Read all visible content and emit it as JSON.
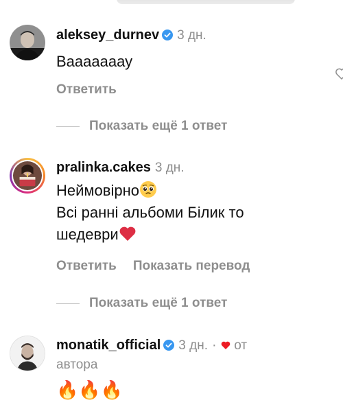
{
  "comments": [
    {
      "username": "aleksey_durnev",
      "verified": true,
      "time": "3 дн.",
      "text": "Вааааааау",
      "reply_label": "Ответить",
      "more_replies": "Показать ещё 1 ответ"
    },
    {
      "username": "pralinka.cakes",
      "verified": false,
      "time": "3 дн.",
      "text_line1": "Неймовірно",
      "text_line2": "Всі ранні альбоми Білик то",
      "text_line3": "шедеври",
      "reply_label": "Ответить",
      "translate_label": "Показать перевод",
      "more_replies": "Показать ещё 1 ответ"
    },
    {
      "username": "monatik_official",
      "verified": true,
      "time": "3 дн.",
      "dot": "·",
      "author_label_1": "от",
      "author_label_2": "автора",
      "text": "🔥🔥🔥"
    }
  ],
  "colors": {
    "text": "#111111",
    "muted": "#8e8e8e",
    "verified": "#3897f0",
    "heart": "#ed1c24"
  }
}
